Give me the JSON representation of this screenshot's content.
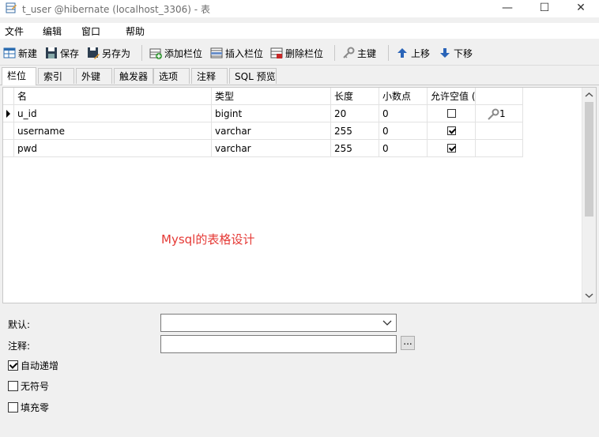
{
  "window": {
    "title": "t_user @hibernate (localhost_3306) - 表",
    "minimize": "—",
    "maximize": "☐",
    "close": "✕"
  },
  "menu": [
    "文件",
    "编辑",
    "窗口",
    "帮助"
  ],
  "toolbar": {
    "new": "新建",
    "save": "保存",
    "save_as": "另存为",
    "add_field": "添加栏位",
    "insert_field": "插入栏位",
    "delete_field": "删除栏位",
    "primary_key": "主键",
    "move_up": "上移",
    "move_down": "下移"
  },
  "tabs": [
    "栏位",
    "索引",
    "外键",
    "触发器",
    "选项",
    "注释",
    "SQL 预览"
  ],
  "grid": {
    "headers": [
      "名",
      "类型",
      "长度",
      "小数点",
      "允许空值 ("
    ],
    "rows": [
      {
        "name": "u_id",
        "type": "bigint",
        "length": "20",
        "decimals": "0",
        "nullable": false,
        "key": "1"
      },
      {
        "name": "username",
        "type": "varchar",
        "length": "255",
        "decimals": "0",
        "nullable": true,
        "key": ""
      },
      {
        "name": "pwd",
        "type": "varchar",
        "length": "255",
        "decimals": "0",
        "nullable": true,
        "key": ""
      }
    ]
  },
  "annotation": "Mysql的表格设计",
  "properties": {
    "default_label": "默认:",
    "default_value": "",
    "comment_label": "注释:",
    "comment_value": "",
    "dots": "...",
    "auto_increment": {
      "label": "自动递增",
      "checked": true
    },
    "unsigned": {
      "label": "无符号",
      "checked": false
    },
    "zerofill": {
      "label": "填充零",
      "checked": false
    }
  }
}
